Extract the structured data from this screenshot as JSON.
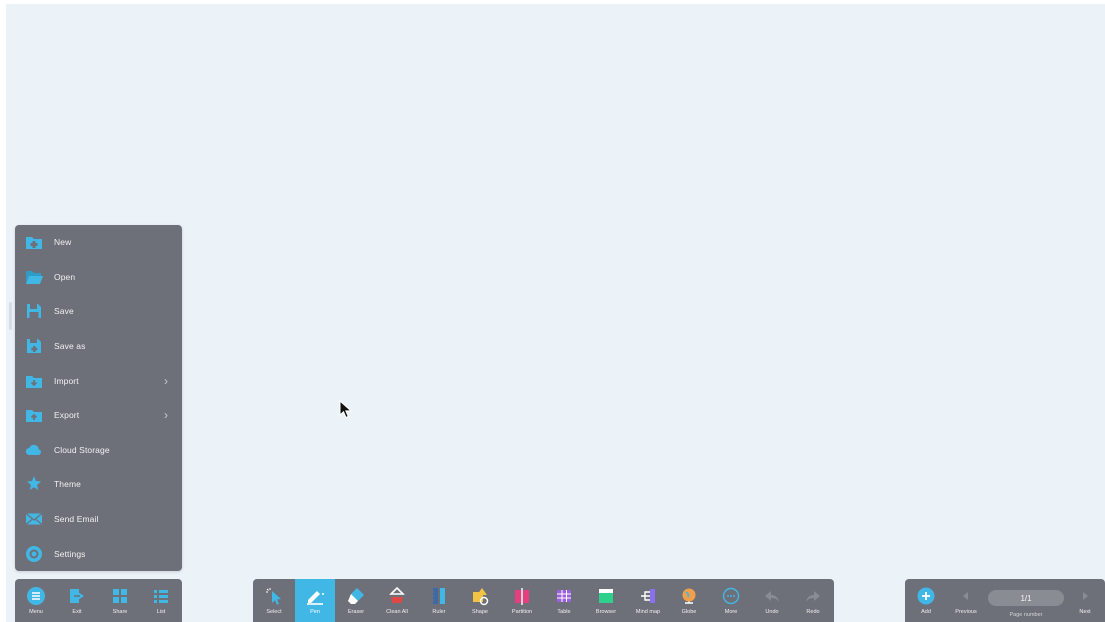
{
  "menu": {
    "items": [
      {
        "label": "New",
        "icon": "new-folder-icon",
        "has_submenu": false
      },
      {
        "label": "Open",
        "icon": "open-folder-icon",
        "has_submenu": false
      },
      {
        "label": "Save",
        "icon": "save-icon",
        "has_submenu": false
      },
      {
        "label": "Save as",
        "icon": "save-as-icon",
        "has_submenu": false
      },
      {
        "label": "Import",
        "icon": "import-icon",
        "has_submenu": true
      },
      {
        "label": "Export",
        "icon": "export-icon",
        "has_submenu": true
      },
      {
        "label": "Cloud Storage",
        "icon": "cloud-icon",
        "has_submenu": false
      },
      {
        "label": "Theme",
        "icon": "theme-icon",
        "has_submenu": false
      },
      {
        "label": "Send Email",
        "icon": "email-icon",
        "has_submenu": false
      },
      {
        "label": "Settings",
        "icon": "settings-icon",
        "has_submenu": false
      }
    ],
    "chevron": "›"
  },
  "left_bar": [
    {
      "label": "Menu",
      "icon": "menu-icon"
    },
    {
      "label": "Exit",
      "icon": "exit-icon"
    },
    {
      "label": "Share",
      "icon": "share-icon"
    },
    {
      "label": "List",
      "icon": "list-icon"
    }
  ],
  "toolbar": {
    "active_tool": "Pen",
    "tools": [
      {
        "label": "Select",
        "icon": "select-icon"
      },
      {
        "label": "Pen",
        "icon": "pen-icon"
      },
      {
        "label": "Eraser",
        "icon": "eraser-icon"
      },
      {
        "label": "Clean All",
        "icon": "clean-all-icon"
      },
      {
        "label": "Ruler",
        "icon": "ruler-icon"
      },
      {
        "label": "Shape",
        "icon": "shape-icon"
      },
      {
        "label": "Partition",
        "icon": "partition-icon"
      },
      {
        "label": "Table",
        "icon": "table-icon"
      },
      {
        "label": "Browser",
        "icon": "browser-icon"
      },
      {
        "label": "Mind map",
        "icon": "mind-map-icon"
      },
      {
        "label": "Globe",
        "icon": "globe-icon"
      },
      {
        "label": "More",
        "icon": "more-icon"
      },
      {
        "label": "Undo",
        "icon": "undo-icon"
      },
      {
        "label": "Redo",
        "icon": "redo-icon"
      }
    ]
  },
  "page_bar": {
    "add_label": "Add",
    "previous_label": "Previous",
    "next_label": "Next",
    "page_value": "1/1",
    "page_caption": "Page number"
  },
  "colors": {
    "canvas": "#ecf3f8",
    "panel": "#6e7079",
    "accent": "#41b7e6"
  }
}
